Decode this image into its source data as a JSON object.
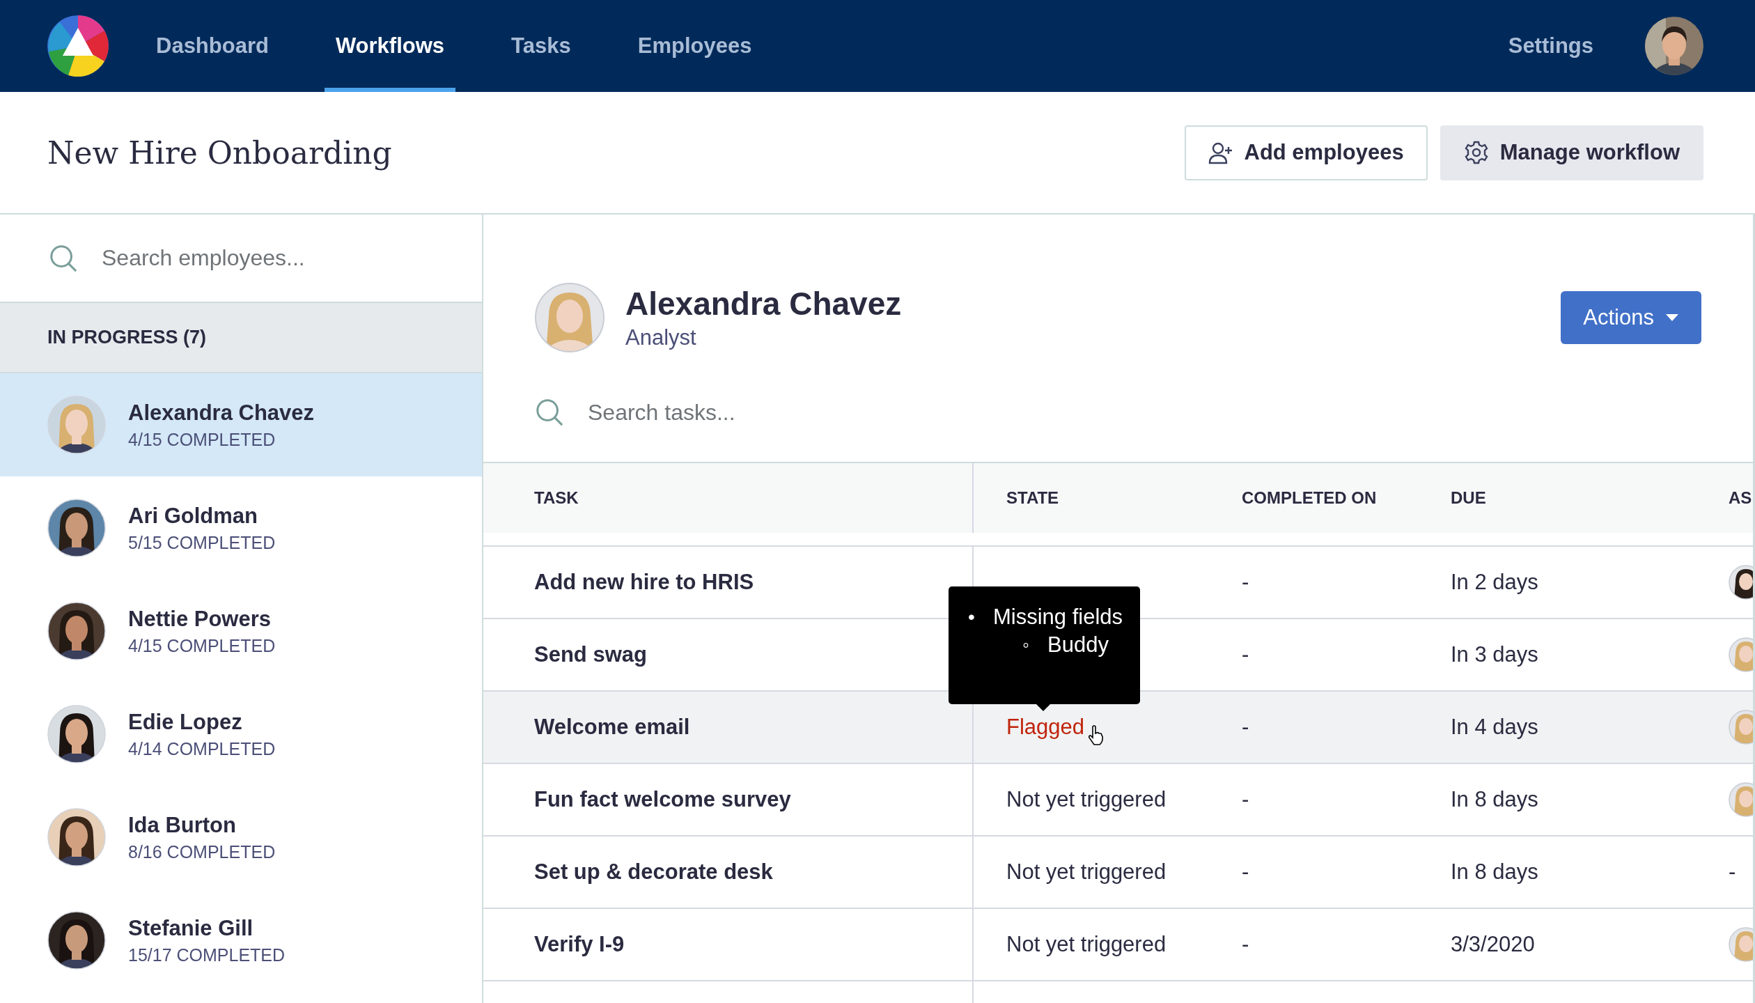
{
  "nav": {
    "items": [
      {
        "label": "Dashboard",
        "selected": false
      },
      {
        "label": "Workflows",
        "selected": true
      },
      {
        "label": "Tasks",
        "selected": false
      },
      {
        "label": "Employees",
        "selected": false
      }
    ],
    "settings": "Settings"
  },
  "header": {
    "title": "New Hire Onboarding",
    "buttons": [
      {
        "label": "Add employees",
        "kind": "outline"
      },
      {
        "label": "Manage workflow",
        "kind": "filled"
      }
    ]
  },
  "sidebar": {
    "search_placeholder": "Search employees...",
    "group": "IN PROGRESS (7)",
    "employees": [
      {
        "name": "Alexandra Chavez",
        "progress": "4/15 COMPLETED",
        "selected": true
      },
      {
        "name": "Ari Goldman",
        "progress": "5/15 COMPLETED",
        "selected": false
      },
      {
        "name": "Nettie Powers",
        "progress": "4/15 COMPLETED",
        "selected": false
      },
      {
        "name": "Edie Lopez",
        "progress": "4/14 COMPLETED",
        "selected": false
      },
      {
        "name": "Ida Burton",
        "progress": "8/16 COMPLETED",
        "selected": false
      },
      {
        "name": "Stefanie Gill",
        "progress": "15/17 COMPLETED",
        "selected": false
      }
    ]
  },
  "profile": {
    "name": "Alexandra Chavez",
    "role": "Analyst",
    "actions": "Actions"
  },
  "tasks": {
    "search_placeholder": "Search tasks...",
    "columns": [
      "TASK",
      "STATE",
      "COMPLETED ON",
      "DUE",
      "AS"
    ],
    "rows": [
      {
        "task": "Add new hire to HRIS",
        "completed_on": "-",
        "due": "In 2 days",
        "hovered": false
      },
      {
        "task": "Send swag",
        "completed_on": "-",
        "due": "In 3 days",
        "hovered": false
      },
      {
        "task": "Welcome email",
        "state": "Flagged",
        "flagged": true,
        "completed_on": "-",
        "due": "In 4 days",
        "hovered": true,
        "tooltip": {
          "items": [
            {
              "marker": "•",
              "text": "Missing fields",
              "children": [
                {
                  "marker": "◦",
                  "text": "Buddy"
                }
              ]
            }
          ]
        }
      },
      {
        "task": "Fun fact welcome survey",
        "state": "Not yet triggered",
        "flagged": false,
        "completed_on": "-",
        "due": "In 8 days",
        "hovered": false
      },
      {
        "task": "Set up & decorate desk",
        "state": "Not yet triggered",
        "flagged": false,
        "completed_on": "-",
        "due": "In 8 days",
        "assignee": {
          "kind": "text",
          "text": "-"
        },
        "hovered": false
      },
      {
        "task": "Verify I-9",
        "state": "Not yet triggered",
        "flagged": false,
        "completed_on": "-",
        "due": "3/3/2020",
        "hovered": false
      }
    ]
  }
}
